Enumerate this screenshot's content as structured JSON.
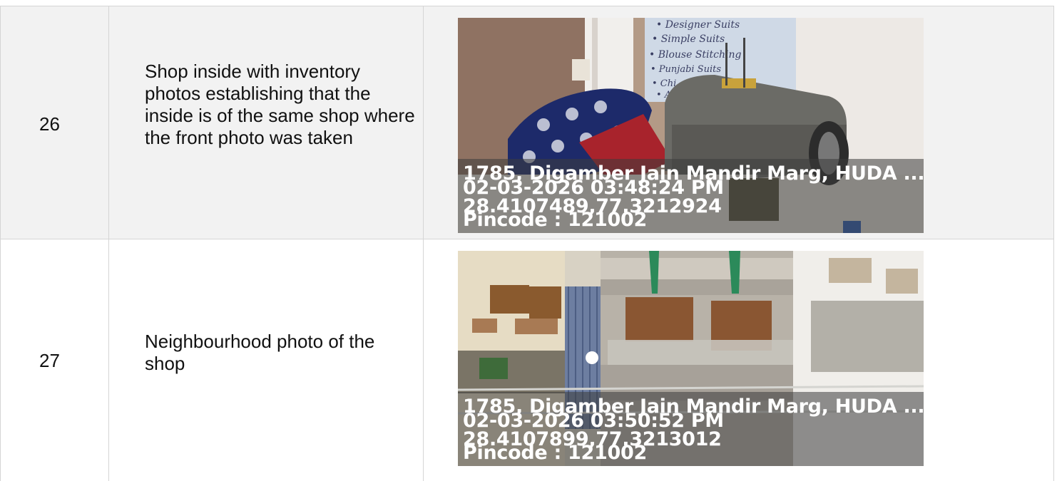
{
  "rows": [
    {
      "number": "26",
      "description": "Shop inside with inventory photos establishing that the inside is of the same shop where the front photo was taken",
      "photo": {
        "board_text": [
          "• Designer Suits",
          "• Simple Suits",
          "• Blouse Stitching",
          "• Punjabi Suits",
          "• Chi",
          "• All"
        ],
        "stamp": {
          "address": "1785, Digamber Jain Mandir Marg, HUDA ...",
          "datetime": "02-03-2026 03:48:24 PM",
          "coords": "28.4107489,77.3212924",
          "pincode": "Pincode : 121002"
        }
      }
    },
    {
      "number": "27",
      "description": "Neighbourhood photo of the shop",
      "photo": {
        "stamp": {
          "address": "1785, Digamber Jain Mandir Marg, HUDA ...",
          "datetime": "02-03-2026 03:50:52 PM",
          "coords": "28.4107899,77.3213012",
          "pincode": "Pincode : 121002"
        }
      }
    }
  ]
}
